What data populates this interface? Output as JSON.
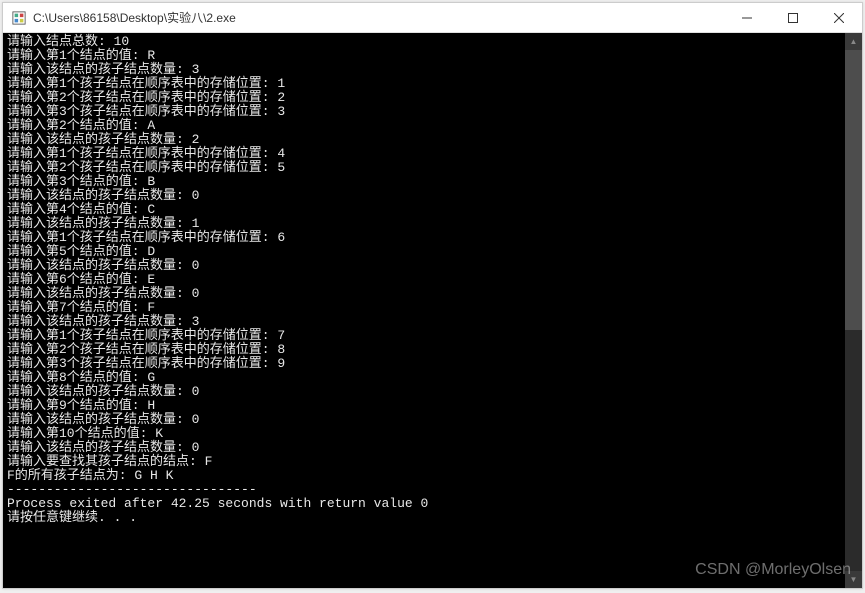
{
  "window": {
    "title": "C:\\Users\\86158\\Desktop\\实验八\\2.exe"
  },
  "console": {
    "lines": [
      "请输入结点总数: 10",
      "请输入第1个结点的值: R",
      "请输入该结点的孩子结点数量: 3",
      "请输入第1个孩子结点在顺序表中的存储位置: 1",
      "请输入第2个孩子结点在顺序表中的存储位置: 2",
      "请输入第3个孩子结点在顺序表中的存储位置: 3",
      "请输入第2个结点的值: A",
      "请输入该结点的孩子结点数量: 2",
      "请输入第1个孩子结点在顺序表中的存储位置: 4",
      "请输入第2个孩子结点在顺序表中的存储位置: 5",
      "请输入第3个结点的值: B",
      "请输入该结点的孩子结点数量: 0",
      "请输入第4个结点的值: C",
      "请输入该结点的孩子结点数量: 1",
      "请输入第1个孩子结点在顺序表中的存储位置: 6",
      "请输入第5个结点的值: D",
      "请输入该结点的孩子结点数量: 0",
      "请输入第6个结点的值: E",
      "请输入该结点的孩子结点数量: 0",
      "请输入第7个结点的值: F",
      "请输入该结点的孩子结点数量: 3",
      "请输入第1个孩子结点在顺序表中的存储位置: 7",
      "请输入第2个孩子结点在顺序表中的存储位置: 8",
      "请输入第3个孩子结点在顺序表中的存储位置: 9",
      "请输入第8个结点的值: G",
      "请输入该结点的孩子结点数量: 0",
      "请输入第9个结点的值: H",
      "请输入该结点的孩子结点数量: 0",
      "请输入第10个结点的值: K",
      "请输入该结点的孩子结点数量: 0",
      "请输入要查找其孩子结点的结点: F",
      "F的所有孩子结点为: G H K",
      "--------------------------------",
      "Process exited after 42.25 seconds with return value 0",
      "请按任意键继续. . ."
    ]
  },
  "watermark": "CSDN @MorleyOlsen"
}
